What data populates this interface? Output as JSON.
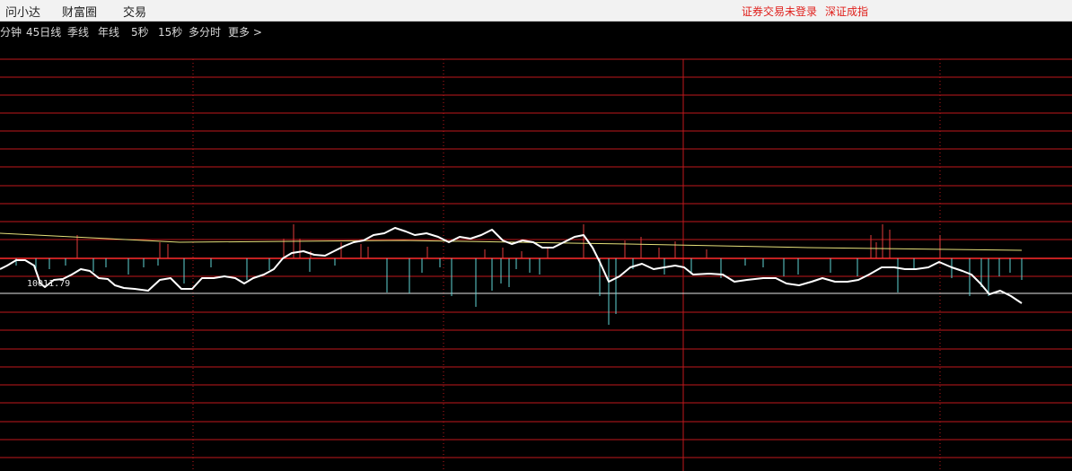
{
  "menubar": {
    "items": [
      "问小达",
      "财富圈",
      "交易"
    ],
    "status": [
      "证券交易未登录",
      "深证成指"
    ]
  },
  "toolbar": {
    "periods": [
      "分钟",
      "45日线",
      "季线",
      "年线",
      "5秒",
      "15秒",
      "多分时",
      "更多 >"
    ]
  },
  "chart": {
    "price_label": "10011.79",
    "colors": {
      "grid": "#c0171c",
      "baseline": "#ff2a2a",
      "price_line": "#ffffff",
      "avg_line": "#e6e07a",
      "volume_up": "#e23b3b",
      "volume_down": "#5fd4d4"
    }
  }
}
